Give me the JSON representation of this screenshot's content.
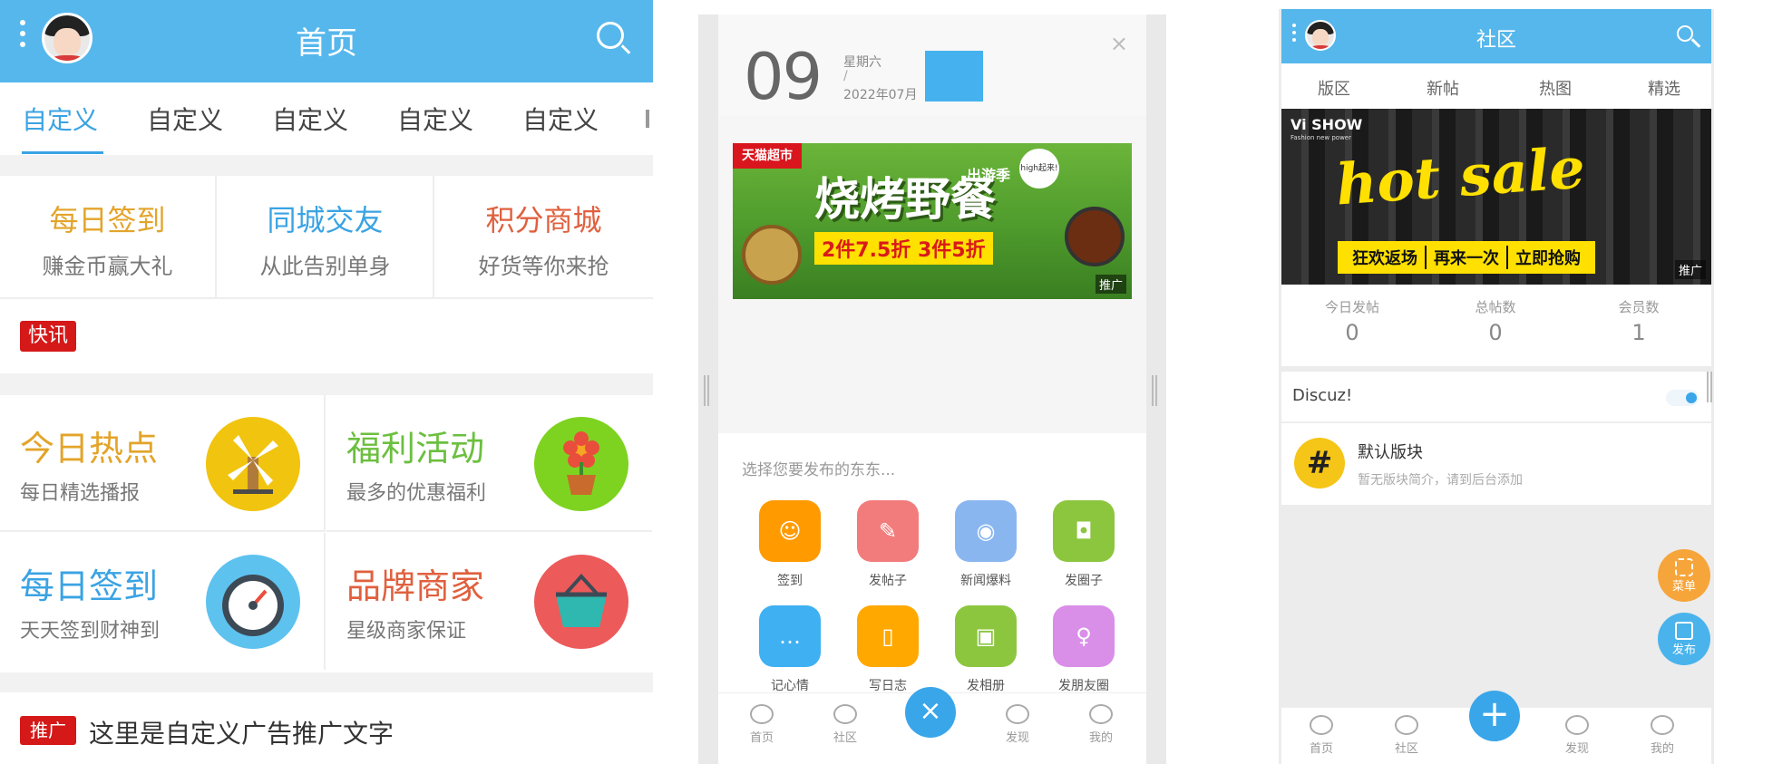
{
  "screen1": {
    "header": {
      "title": "首页"
    },
    "tabs": [
      "自定义",
      "自定义",
      "自定义",
      "自定义",
      "自定义"
    ],
    "features": [
      {
        "title": "每日签到",
        "subtitle": "赚金币赢大礼",
        "color": "#e3a42a"
      },
      {
        "title": "同城交友",
        "subtitle": "从此告别单身",
        "color": "#3aa3e3"
      },
      {
        "title": "积分商城",
        "subtitle": "好货等你来抢",
        "color": "#e0603e"
      }
    ],
    "news_badge": "快讯",
    "grid": [
      {
        "title": "今日热点",
        "subtitle": "每日精选播报",
        "color": "#e3a42a",
        "icon": "windmill-icon",
        "icon_bg": "#f1c40f"
      },
      {
        "title": "福利活动",
        "subtitle": "最多的优惠福利",
        "color": "#6cbf3f",
        "icon": "flower-pot-icon",
        "icon_bg": "#7ed321"
      },
      {
        "title": "每日签到",
        "subtitle": "天天签到财神到",
        "color": "#3aa3e3",
        "icon": "speedometer-icon",
        "icon_bg": "#5ec2ef"
      },
      {
        "title": "品牌商家",
        "subtitle": "星级商家保证",
        "color": "#e0603e",
        "icon": "basket-icon",
        "icon_bg": "#ec5a5a"
      }
    ],
    "ad": {
      "badge": "推广",
      "text": "这里是自定义广告推广文字"
    }
  },
  "screen2": {
    "day": "09",
    "weekday": "星期六",
    "slash": "/",
    "month": "2022年07月",
    "banner": {
      "brand": "天猫超市",
      "headline": "烧烤野餐",
      "tagline": "出游季",
      "promo": "2件7.5折 3件5折",
      "bubble": "high起来!",
      "tag": "推广"
    },
    "prompt": "选择您要发布的东东...",
    "actions": [
      {
        "label": "签到",
        "color": "#ff9a00",
        "icon": "smile-icon",
        "glyph": "☺"
      },
      {
        "label": "发帖子",
        "color": "#f27c7c",
        "icon": "chat-bubble-icon",
        "glyph": "✎"
      },
      {
        "label": "新闻爆料",
        "color": "#8ab6f0",
        "icon": "broadcast-icon",
        "glyph": "◉"
      },
      {
        "label": "发圈子",
        "color": "#8cc63f",
        "icon": "camera-icon",
        "glyph": "◘"
      },
      {
        "label": "记心情",
        "color": "#3fb0f2",
        "icon": "message-icon",
        "glyph": "…"
      },
      {
        "label": "写日志",
        "color": "#ffa800",
        "icon": "notebook-icon",
        "glyph": "▯"
      },
      {
        "label": "发相册",
        "color": "#8cc63f",
        "icon": "picture-icon",
        "glyph": "▣"
      },
      {
        "label": "发朋友圈",
        "color": "#d98ee8",
        "icon": "bulb-icon",
        "glyph": "♀"
      }
    ],
    "nav": [
      "首页",
      "社区",
      "发现",
      "我的"
    ],
    "close_glyph": "×"
  },
  "screen3": {
    "header": {
      "title": "社区"
    },
    "tabs": [
      "版区",
      "新帖",
      "热图",
      "精选"
    ],
    "banner": {
      "brand": "Vi SHOW",
      "brand_sub": "Fashion new power",
      "headline": "hot sale",
      "slogans": [
        "狂欢返场",
        "再来一次",
        "立即抢购"
      ],
      "tag": "推广"
    },
    "stats": [
      {
        "label": "今日发帖",
        "value": "0"
      },
      {
        "label": "总帖数",
        "value": "0"
      },
      {
        "label": "会员数",
        "value": "1"
      }
    ],
    "section": "Discuz!",
    "forum": {
      "name": "默认版块",
      "desc": "暂无版块简介，请到后台添加",
      "icon_color": "#f5c518"
    },
    "fabs": [
      {
        "label": "菜单",
        "color": "#f6a53a"
      },
      {
        "label": "发布",
        "color": "#4ab3ec"
      }
    ],
    "nav": [
      "首页",
      "社区",
      "发现",
      "我的"
    ],
    "plus": "+"
  }
}
